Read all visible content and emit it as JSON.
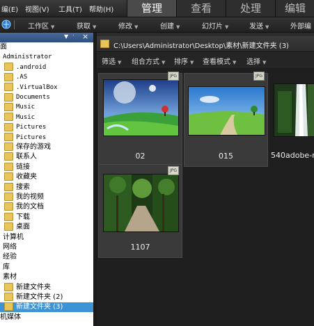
{
  "menubar": {
    "items": [
      "编(E)",
      "视图(V)",
      "工具(T)",
      "帮助(H)"
    ],
    "tabs": [
      "管理",
      "查看",
      "处理",
      "编辑"
    ],
    "active_tab": "管理"
  },
  "toolbar": {
    "items": [
      "工作区",
      "获取",
      "修改",
      "创建",
      "幻灯片",
      "发送",
      "外部编"
    ]
  },
  "sidebar": {
    "rows": [
      {
        "label": "面",
        "indent": 0,
        "folder": false,
        "mono": false
      },
      {
        "label": "Administrator",
        "indent": 4,
        "folder": false,
        "mono": true
      },
      {
        "label": ".android",
        "indent": 6,
        "folder": true,
        "mono": true
      },
      {
        "label": ".AS",
        "indent": 6,
        "folder": true,
        "mono": true
      },
      {
        "label": ".VirtualBox",
        "indent": 6,
        "folder": true,
        "mono": true
      },
      {
        "label": "Documents",
        "indent": 6,
        "folder": true,
        "mono": true
      },
      {
        "label": "Music",
        "indent": 6,
        "folder": true,
        "mono": true
      },
      {
        "label": "Music",
        "indent": 6,
        "folder": true,
        "mono": true
      },
      {
        "label": "Pictures",
        "indent": 6,
        "folder": true,
        "mono": true
      },
      {
        "label": "Pictures",
        "indent": 6,
        "folder": true,
        "mono": true
      },
      {
        "label": "保存的游戏",
        "indent": 6,
        "folder": true,
        "mono": false
      },
      {
        "label": "联系人",
        "indent": 6,
        "folder": true,
        "mono": false
      },
      {
        "label": "链接",
        "indent": 6,
        "folder": true,
        "mono": false
      },
      {
        "label": "收藏夹",
        "indent": 6,
        "folder": true,
        "mono": false
      },
      {
        "label": "搜索",
        "indent": 6,
        "folder": true,
        "mono": false
      },
      {
        "label": "我的视频",
        "indent": 6,
        "folder": true,
        "mono": false
      },
      {
        "label": "我的文档",
        "indent": 6,
        "folder": true,
        "mono": false
      },
      {
        "label": "下载",
        "indent": 6,
        "folder": true,
        "mono": false
      },
      {
        "label": "桌面",
        "indent": 6,
        "folder": true,
        "mono": false
      },
      {
        "label": "计算机",
        "indent": 4,
        "folder": false,
        "mono": false
      },
      {
        "label": "网络",
        "indent": 4,
        "folder": false,
        "mono": false
      },
      {
        "label": "经验",
        "indent": 4,
        "folder": false,
        "mono": false
      },
      {
        "label": "库",
        "indent": 4,
        "folder": false,
        "mono": false
      },
      {
        "label": "素材",
        "indent": 4,
        "folder": false,
        "mono": false
      },
      {
        "label": "新建文件夹",
        "indent": 6,
        "folder": true,
        "mono": false
      },
      {
        "label": "新建文件夹 (2)",
        "indent": 6,
        "folder": true,
        "mono": false
      },
      {
        "label": "新建文件夹 (3)",
        "indent": 6,
        "folder": true,
        "mono": false,
        "selected": true
      },
      {
        "label": "机媒体",
        "indent": 0,
        "folder": false,
        "mono": false
      }
    ]
  },
  "pathbar": {
    "path": "C:\\Users\\Administrator\\Desktop\\素材\\新建文件夹 (3)"
  },
  "filterbar": {
    "items": [
      "筛选",
      "组合方式",
      "排序",
      "查看模式",
      "选择"
    ]
  },
  "thumbnails": [
    {
      "label": "02",
      "badge": "JPG"
    },
    {
      "label": "015",
      "badge": "JPG"
    },
    {
      "label": "540adobe-r",
      "badge": ""
    },
    {
      "label": "1107",
      "badge": "JPG"
    }
  ]
}
